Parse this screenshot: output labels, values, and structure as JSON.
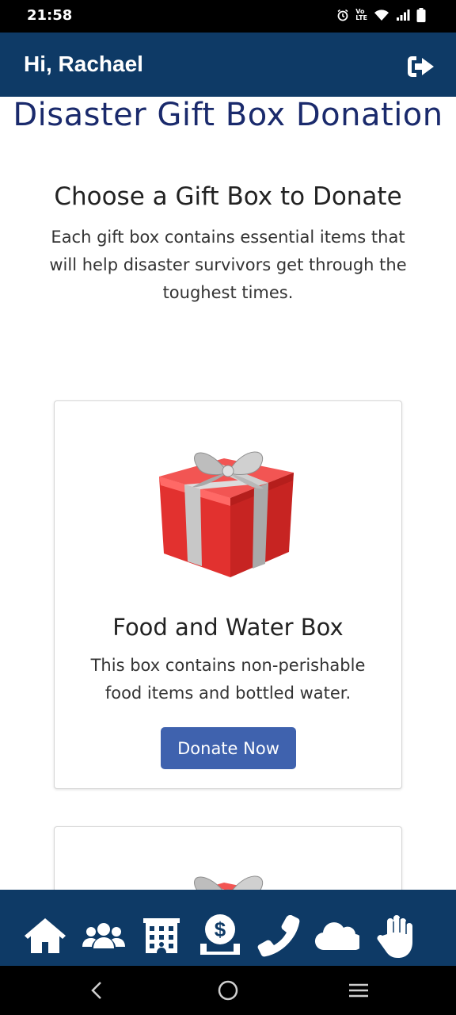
{
  "status_bar": {
    "time": "21:58",
    "volte_line1": "Vo",
    "volte_line2": "LTE",
    "icons": [
      "alarm-icon",
      "volte-icon",
      "wifi-icon",
      "signal-icon",
      "battery-icon"
    ]
  },
  "header": {
    "greeting": "Hi, Rachael",
    "logout_icon": "sign-out-icon",
    "background": "#0e3a66"
  },
  "main": {
    "page_title": "Disaster Gift Box Donation",
    "section_title": "Choose a Gift Box to Donate",
    "section_description": "Each gift box contains essential items that will help disaster survivors get through the toughest times.",
    "cards": [
      {
        "title": "Food and Water Box",
        "description": "This box contains non-perishable food items and bottled water.",
        "button_label": "Donate Now",
        "image_icon": "gift-box-icon"
      }
    ]
  },
  "bottom_nav": {
    "items": [
      {
        "icon": "home-icon"
      },
      {
        "icon": "users-icon"
      },
      {
        "icon": "building-icon"
      },
      {
        "icon": "donate-dollar-icon"
      },
      {
        "icon": "phone-icon"
      },
      {
        "icon": "cloud-icon"
      },
      {
        "icon": "hand-icon"
      }
    ]
  },
  "colors": {
    "primary": "#0e3a66",
    "title": "#1a2a6c",
    "button": "#3f62ae"
  }
}
